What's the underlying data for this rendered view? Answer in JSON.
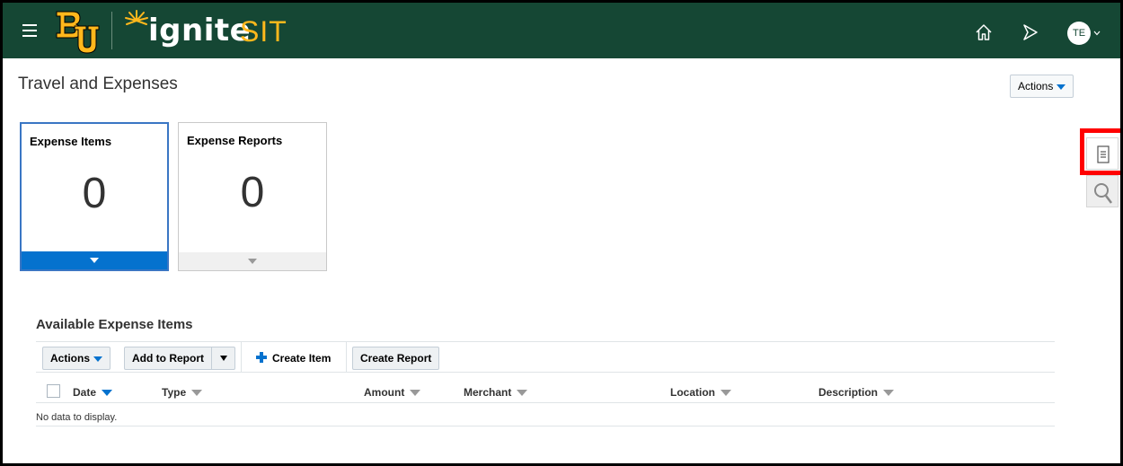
{
  "header": {
    "logo_text": "BU",
    "brand": "ignite",
    "environment": "SIT",
    "avatar_initials": "TE",
    "colors": {
      "background": "#154734",
      "accent": "#FFB81C"
    }
  },
  "page": {
    "title": "Travel and Expenses",
    "actions_label": "Actions"
  },
  "tiles": [
    {
      "label": "Expense Items",
      "count": "0",
      "selected": true
    },
    {
      "label": "Expense Reports",
      "count": "0",
      "selected": false
    }
  ],
  "side_panel": {
    "icons": [
      "list-icon",
      "search-icon"
    ]
  },
  "expense_items": {
    "title": "Available Expense Items",
    "toolbar": {
      "actions_label": "Actions",
      "add_to_report_label": "Add to Report",
      "create_item_label": "Create Item",
      "create_report_label": "Create Report"
    },
    "columns": [
      "Date",
      "Type",
      "Amount",
      "Merchant",
      "Location",
      "Description"
    ],
    "empty_message": "No data to display."
  }
}
